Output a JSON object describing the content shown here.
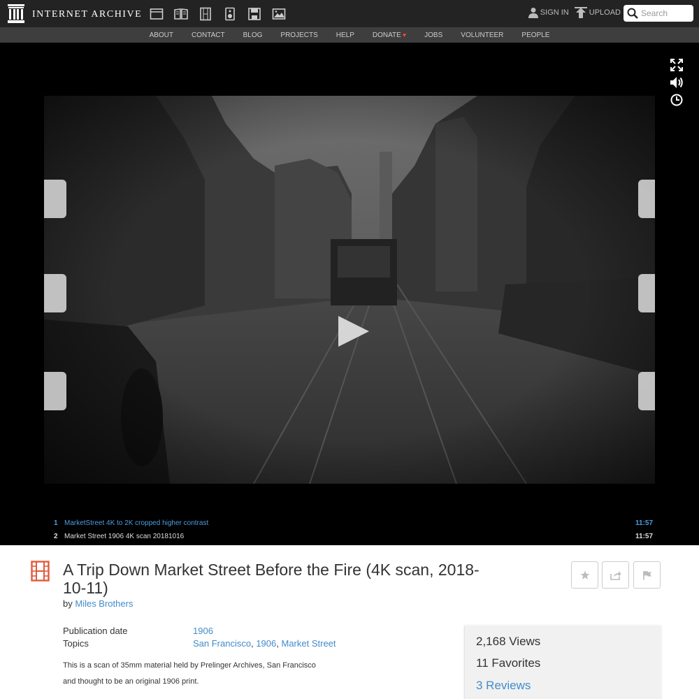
{
  "header": {
    "logo_text": "INTERNET ARCHIVE",
    "media_icons": [
      "web-icon",
      "texts-icon",
      "video-icon",
      "audio-icon",
      "software-icon",
      "images-icon"
    ],
    "sign_in": "SIGN IN",
    "upload": "UPLOAD",
    "search_placeholder": "Search"
  },
  "nav": {
    "items": [
      "ABOUT",
      "CONTACT",
      "BLOG",
      "PROJECTS",
      "HELP",
      "DONATE",
      "JOBS",
      "VOLUNTEER",
      "PEOPLE"
    ]
  },
  "player": {
    "playlist": [
      {
        "num": "1",
        "title": "MarketStreet 4K to 2K cropped higher contrast",
        "duration": "11:57",
        "active": true
      },
      {
        "num": "2",
        "title": "Market Street 1906 4K scan 20181016",
        "duration": "11:57",
        "active": false
      }
    ]
  },
  "item": {
    "title": "A Trip Down Market Street Before the Fire (4K scan, 2018-10-11)",
    "by_label": "by",
    "creator": "Miles Brothers",
    "metadata": [
      {
        "key": "Publication date",
        "values": [
          "1906"
        ]
      },
      {
        "key": "Topics",
        "values": [
          "San Francisco",
          "1906",
          "Market Street"
        ]
      }
    ],
    "description": [
      "This is a scan of 35mm material held by Prelinger Archives, San Francisco",
      "and thought to be an original 1906 print."
    ],
    "stats": {
      "views": "2,168 Views",
      "favorites": "11 Favorites",
      "reviews": "3 Reviews"
    }
  },
  "colors": {
    "topbar": "#232323",
    "navbar": "#3e3e3e",
    "link": "#428bca",
    "playlist_active": "#4b9fe1",
    "film_icon": "#e05b3b",
    "donate_heart": "#ff4433"
  }
}
